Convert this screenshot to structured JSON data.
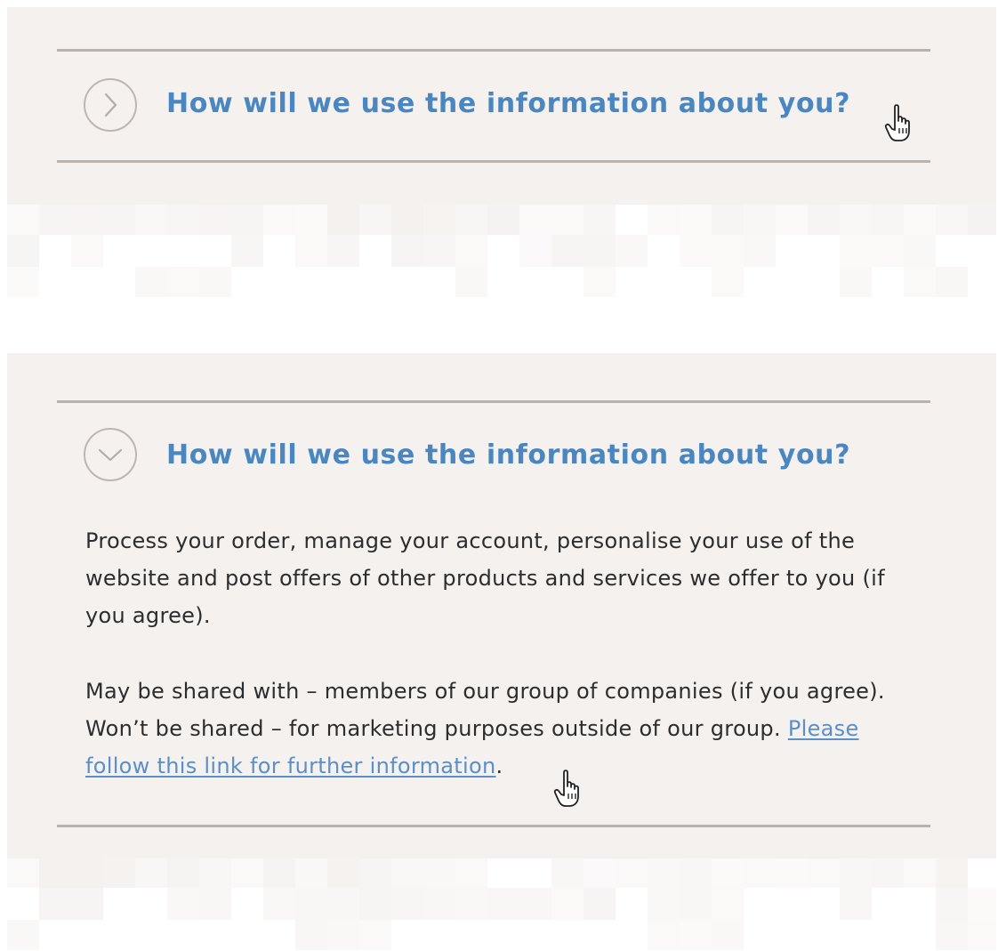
{
  "collapsed_section": {
    "state": "collapsed",
    "heading": "How will we use the information about you?",
    "icon": "chevron-right-icon"
  },
  "expanded_section": {
    "state": "expanded",
    "heading": "How will we use the information about you?",
    "icon": "chevron-down-icon",
    "paragraph1": "Process your order, manage your account, personalise your use of the website and post offers of other products and services we offer to you (if you agree).",
    "paragraph2_prefix": "May be shared with – members of our group of companies (if you agree). Won’t be shared – for marketing purposes outside of our group. ",
    "link_text": "Please follow this link for further information",
    "paragraph2_suffix": "."
  },
  "colors": {
    "panel_background": "#f4f1ef",
    "heading": "#4a86c0",
    "link": "#5b8fc8",
    "body_text": "#2d2d2d",
    "rule": "#b9b2ad"
  }
}
